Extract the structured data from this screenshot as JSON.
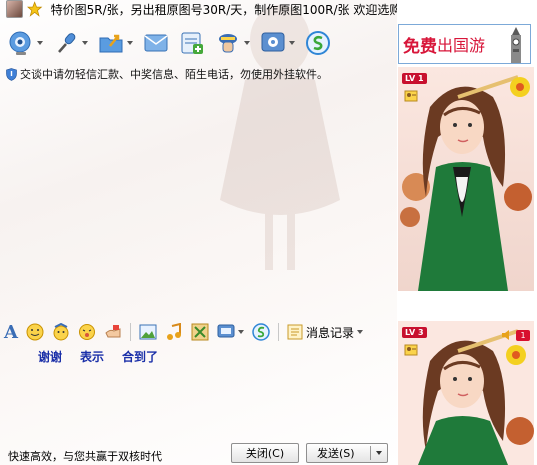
{
  "status_bar": {
    "text": "特价图5R/张，另出租原图号30R/天，制作原图100R/张 欢迎选购 .."
  },
  "toolbar": {
    "icons": [
      "video-call-icon",
      "voice-call-icon",
      "send-file-icon",
      "send-email-icon",
      "create-group-icon",
      "app-manager-icon",
      "remote-assist-icon",
      "soso-icon"
    ]
  },
  "warning": {
    "text": "交谈中请勿轻信汇款、中奖信息、陌生电话，勿使用外挂软件。"
  },
  "format_toolbar": {
    "font_label": "A",
    "message_history": "消息记录"
  },
  "quick_replies": [
    "谢谢",
    "表示",
    "合到了"
  ],
  "bottom": {
    "slogan": "快速高效，与您共赢于双核时代",
    "close_label": "关闭(C)",
    "send_label": "发送(S)"
  },
  "right_panel": {
    "ad": {
      "text_main": "免费",
      "text_rest": "出国游"
    },
    "top_badge": "LV 1",
    "bottom_badge": "LV 3",
    "message_count": "1"
  },
  "colors": {
    "accent_blue": "#1a2fa8",
    "ad_red": "#d8163a",
    "ad_border": "#7ca9d8"
  }
}
